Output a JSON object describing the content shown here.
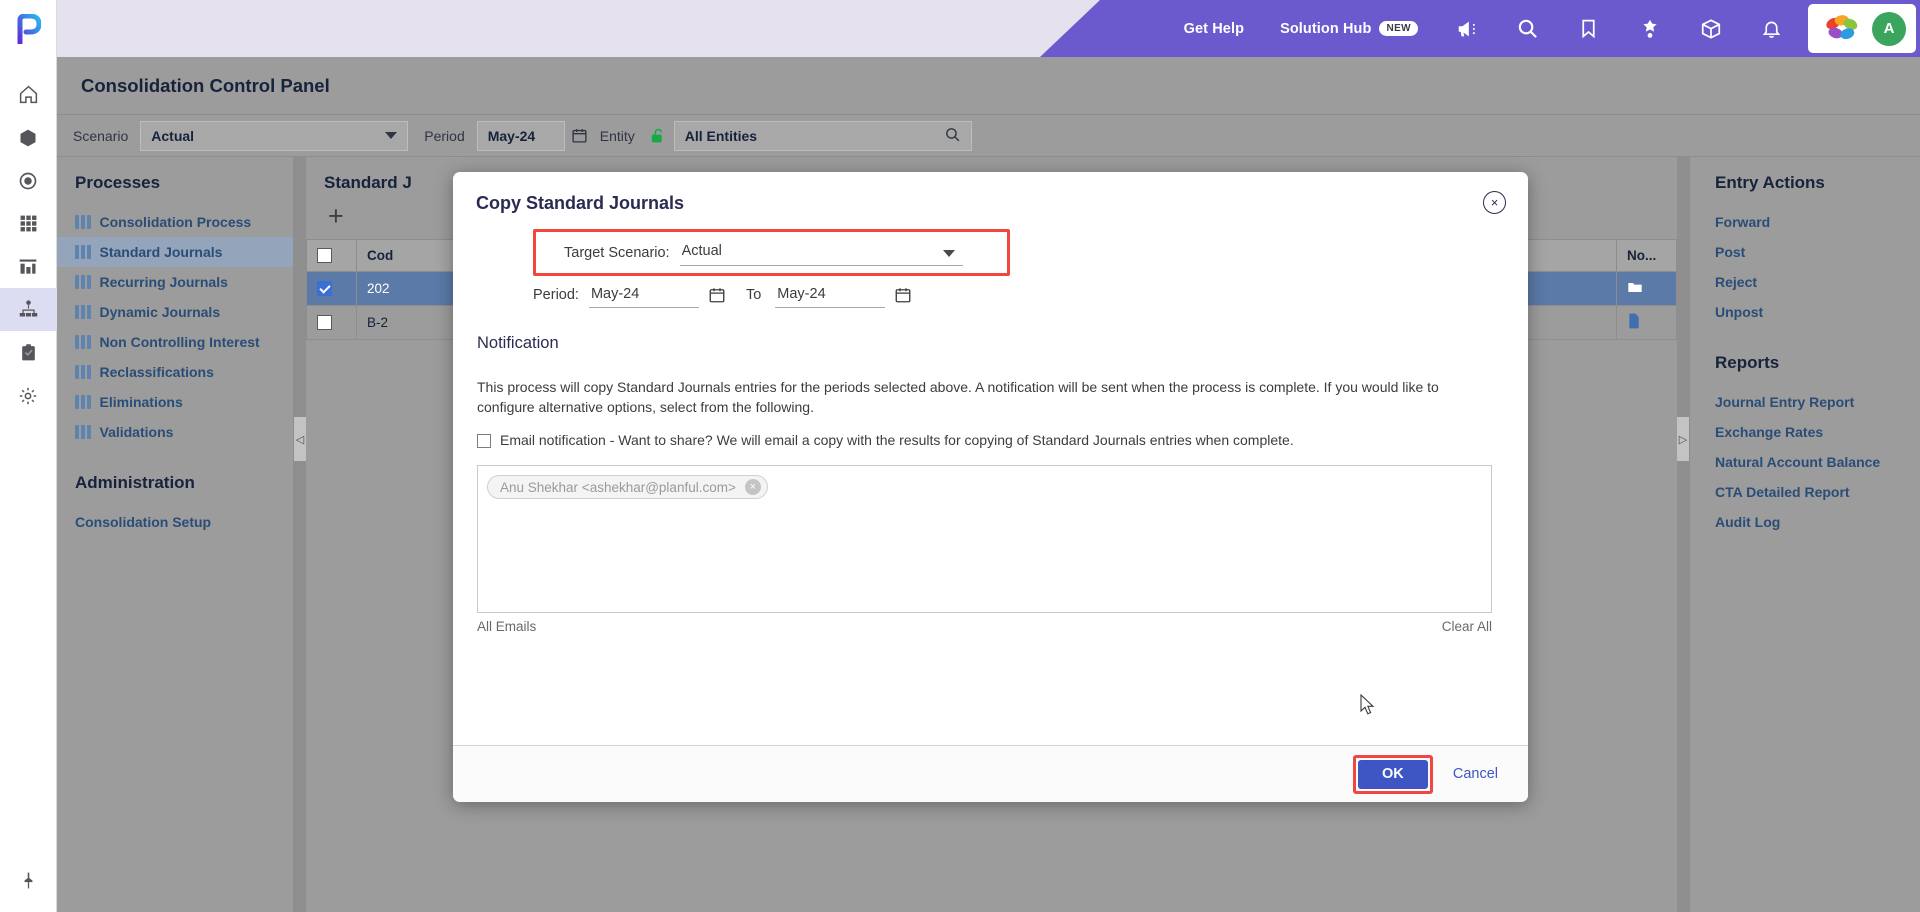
{
  "topbar": {
    "get_help": "Get Help",
    "solution_hub": "Solution Hub",
    "new_badge": "NEW",
    "icons": [
      "megaphone-icon",
      "search-icon",
      "bookmark-icon",
      "puzzle-icon",
      "cube-icon",
      "bell-icon"
    ],
    "avatar_initial": "A",
    "accent": "#6a5acd"
  },
  "page": {
    "title": "Consolidation Control Panel"
  },
  "filters": {
    "scenario_label": "Scenario",
    "scenario_value": "Actual",
    "period_label": "Period",
    "period_value": "May-24",
    "entity_label": "Entity",
    "entity_value": "All Entities"
  },
  "left_panel": {
    "processes_heading": "Processes",
    "processes": [
      {
        "label": "Consolidation Process",
        "active": false
      },
      {
        "label": "Standard Journals",
        "active": true
      },
      {
        "label": "Recurring Journals",
        "active": false
      },
      {
        "label": "Dynamic Journals",
        "active": false
      },
      {
        "label": "Non Controlling Interest",
        "active": false
      },
      {
        "label": "Reclassifications",
        "active": false
      },
      {
        "label": "Eliminations",
        "active": false
      },
      {
        "label": "Validations",
        "active": false
      }
    ],
    "administration_heading": "Administration",
    "administration": [
      {
        "label": "Consolidation Setup"
      }
    ]
  },
  "center_panel": {
    "heading": "Standard J",
    "add_label": "+",
    "columns": [
      "",
      "Cod",
      "No..."
    ],
    "rows": [
      {
        "checked": true,
        "code": "202",
        "selected": true
      },
      {
        "checked": false,
        "code": "B-2",
        "selected": false
      }
    ]
  },
  "right_panel": {
    "entry_actions_heading": "Entry Actions",
    "entry_actions": [
      "Forward",
      "Post",
      "Reject",
      "Unpost"
    ],
    "reports_heading": "Reports",
    "reports": [
      "Journal Entry Report",
      "Exchange Rates",
      "Natural Account Balance",
      "CTA Detailed Report",
      "Audit Log"
    ]
  },
  "modal": {
    "title": "Copy Standard Journals",
    "close_label": "×",
    "target_scenario_label": "Target Scenario:",
    "target_scenario_value": "Actual",
    "period_label": "Period:",
    "period_from": "May-24",
    "to_label": "To",
    "period_to": "May-24",
    "notification_heading": "Notification",
    "notification_text": "This process will copy Standard Journals entries for the periods selected above. A notification will be sent when the process is complete. If you would like to configure alternative options, select from the following.",
    "email_checkbox_label": "Email notification - Want to share? We will email a copy with the results for copying of Standard Journals entries when complete.",
    "email_checked": false,
    "email_chip": "Anu Shekhar <ashekhar@planful.com>",
    "chip_remove": "×",
    "all_emails_label": "All Emails",
    "clear_all_label": "Clear All",
    "ok_label": "OK",
    "cancel_label": "Cancel",
    "highlight_color": "#f2473f",
    "primary_color": "#3d56c4"
  }
}
